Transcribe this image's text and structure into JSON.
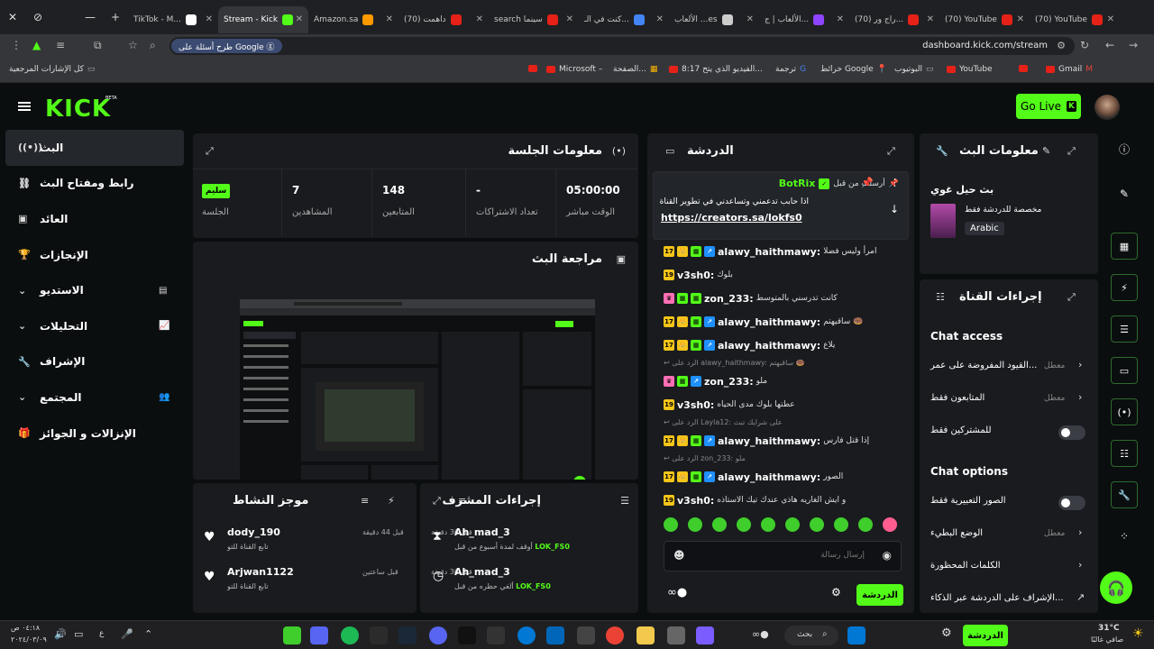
{
  "browser": {
    "tabs": [
      {
        "label": "(70) YouTube",
        "icon_color": "#e62117"
      },
      {
        "label": "(70) YouTube",
        "icon_color": "#e62117"
      },
      {
        "label": "(70) راج ور...",
        "icon_color": "#e62117"
      },
      {
        "label": "الألعاب | ج...",
        "icon_color": "#8e44ff"
      },
      {
        "label": "الألعاب ...es",
        "icon_color": "#cccccc"
      },
      {
        "label": "كنت في الـ...",
        "icon_color": "#4285f4"
      },
      {
        "label": "search سينما",
        "icon_color": "#e62117"
      },
      {
        "label": "(70) داهمت",
        "icon_color": "#e62117"
      },
      {
        "label": "Amazon.sa",
        "icon_color": "#ff9900"
      },
      {
        "label": "Stream - Kick",
        "icon_color": "#53fc18"
      },
      {
        "label": "TikTok - M...",
        "icon_color": "#ffffff"
      }
    ],
    "url": "dashboard.kick.com/stream",
    "google_pill": "طرح أسئلة على Google",
    "bookmarks": [
      "Gmail",
      "",
      "YouTube",
      "",
      "البوتيوب",
      "خرائط Google",
      "ترجمة",
      "8:17 الفيديو الذي يتح...",
      "الصفحة...",
      "Microsoft –",
      "",
      "كل الإشارات المرجعية"
    ]
  },
  "header": {
    "logo": "KICK",
    "beta": "BETA",
    "go_live": "Go Live",
    "go_live_badge": "K"
  },
  "sidebar": {
    "items": [
      {
        "label": "البث",
        "icon": "broadcast-icon",
        "glyph": "((•))"
      },
      {
        "label": "رابط ومفتاح البث",
        "icon": "link-icon",
        "glyph": "⛓"
      },
      {
        "label": "العائد",
        "icon": "revenue-icon",
        "glyph": "▣"
      },
      {
        "label": "الإنجازات",
        "icon": "trophy-icon",
        "glyph": "🏆"
      },
      {
        "label": "الاستديو",
        "icon": "studio-icon",
        "glyph": "▤",
        "expand": "⌄"
      },
      {
        "label": "التحليلات",
        "icon": "analytics-icon",
        "glyph": "📈",
        "expand": "⌄"
      },
      {
        "label": "الإشراف",
        "icon": "wrench-icon",
        "glyph": "🔧"
      },
      {
        "label": "المجتمع",
        "icon": "community-icon",
        "glyph": "👥",
        "expand": "⌄"
      },
      {
        "label": "الإنزالات و الجوائز",
        "icon": "gift-icon",
        "glyph": "🎁"
      }
    ]
  },
  "session": {
    "title": "معلومات الجلسة",
    "stats": [
      {
        "value": "05:00:00",
        "label": "الوقت مباشر"
      },
      {
        "value": "-",
        "label": "تعداد الاشتراكات"
      },
      {
        "value": "148",
        "label": "المتابعين"
      },
      {
        "value": "7",
        "label": "المشاهدين"
      },
      {
        "value": "سليم",
        "label": "الجلسة"
      }
    ]
  },
  "review": {
    "title": "مراجعة البث"
  },
  "activity": {
    "title": "موجز النشاط",
    "items": [
      {
        "name": "dody_190",
        "desc": "تابع القناة للتو",
        "time": "قبل 44 دقيقة"
      },
      {
        "name": "Arjwan1122",
        "desc": "تابع القناة للتو",
        "time": "قبل ساعتين"
      }
    ]
  },
  "mod_actions": {
    "title": "إجراءات المشرف",
    "items": [
      {
        "name": "Ah_mad_3",
        "desc": "أوقف لمدة أسبوع من قبل",
        "by": "LOK_FS0",
        "time": "قبل 36 دقيقة"
      },
      {
        "name": "Ah_mad_3",
        "desc": "ألغي حظره من قبل",
        "by": "LOK_FS0",
        "time": "قبل 36 دقيقة"
      }
    ]
  },
  "chat": {
    "title": "الدردشة",
    "pinned": {
      "by_label": "أرسلت من قبل",
      "user": "BotRix",
      "text": "اذا حابب تدعمني وتساعدني في تطوير القناة",
      "link": "https://creators.sa/lokfs0"
    },
    "messages": [
      {
        "user": "alawy_haithmawy:",
        "text": "امرأ وليس فضلا",
        "badges": [
          "17",
          "👑",
          "▦",
          "↗"
        ]
      },
      {
        "user": "v3sh0:",
        "text": "بلوك",
        "badges": [
          "19"
        ]
      },
      {
        "user": "zon_233:",
        "text": "كانت تدرسني بالمتوسط",
        "badges": [
          "♛",
          "▦",
          "▦"
        ]
      },
      {
        "user": "alawy_haithmawy:",
        "text": "ساقيهتم 🍩",
        "badges": [
          "17",
          "👑",
          "▦",
          "↗"
        ]
      },
      {
        "user": "alawy_haithmawy:",
        "text": "يلاع",
        "badges": [
          "17",
          "👑",
          "▦",
          "↗"
        ]
      },
      {
        "user": "zon_233:",
        "text": "ملو",
        "badges": [
          "♛",
          "▦",
          "↗"
        ],
        "reply": "الرد على alawy_haithmawy: ساقيهتم 🍩"
      },
      {
        "user": "v3sh0:",
        "text": "عطتها بلوك مدى الحياه",
        "badges": [
          "19"
        ]
      },
      {
        "user": "alawy_haithmawy:",
        "text": "إذا قتل فارس",
        "badges": [
          "17",
          "👑",
          "▦",
          "↗"
        ],
        "reply": "الرد على Layla12: على شرايك تبث"
      },
      {
        "user": "alawy_haithmawy:",
        "text": "الصور",
        "badges": [
          "17",
          "👑",
          "▦",
          "↗"
        ],
        "reply": "الرد على zon_233: ملو"
      },
      {
        "user": "v3sh0:",
        "text": "و ايش الغاريه هاذي عندك تيك الاستاذه",
        "badges": [
          "19"
        ]
      }
    ],
    "input_placeholder": "إرسال رسالة",
    "send_label": "الدردشة"
  },
  "stream_info": {
    "title": "بث حيل غوي",
    "category": "مخصصة للدردشة فقط",
    "language": "Arabic"
  },
  "channel_actions": {
    "title": "إجراءات القناة",
    "chat_access_title": "Chat access",
    "chat_access": [
      {
        "label": "القيود المفروضة على عمر...",
        "value": "معطل",
        "type": "chevron"
      },
      {
        "label": "المتابعون فقط",
        "value": "معطل",
        "type": "chevron"
      },
      {
        "label": "للمشتركين فقط",
        "value": "",
        "type": "toggle"
      }
    ],
    "chat_options_title": "Chat options",
    "chat_options": [
      {
        "label": "الصور التعبيرية فقط",
        "value": "",
        "type": "toggle"
      },
      {
        "label": "الوضع البطيء",
        "value": "معطل",
        "type": "chevron"
      },
      {
        "label": "الكلمات المحظورة",
        "value": "",
        "type": "chevron"
      },
      {
        "label": "الإشراف على الدردشة عبر الذكاء...",
        "value": "",
        "type": "link"
      }
    ]
  },
  "taskbar": {
    "time": "٠٤:١٨ ص",
    "date": "٢٠٢٤/٠٣/٠٩",
    "weather_temp": "31°C",
    "weather_desc": "صافي غالبًا",
    "search_label": "بحث",
    "chat_label": "الدردشة",
    "lang": "ع"
  },
  "colors": {
    "accent": "#53fc18",
    "panel": "#191b1f",
    "bg": "#0b0e0f"
  }
}
